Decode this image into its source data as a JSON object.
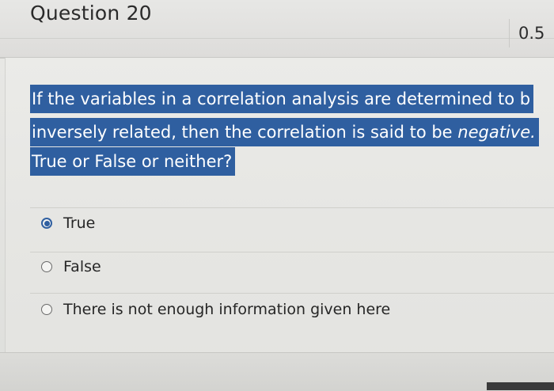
{
  "question": {
    "title": "Question 20",
    "points": "0.5",
    "prompt_lines": [
      "If the variables in a correlation analysis are determined to b",
      "inversely related, then the correlation is said to be ",
      "True or False or neither?"
    ],
    "prompt_emphasis": "negative.",
    "options": [
      {
        "label": "True",
        "selected": true
      },
      {
        "label": "False",
        "selected": false
      },
      {
        "label": "There is not enough information given here",
        "selected": false
      }
    ]
  },
  "colors": {
    "highlight": "#2f5fa0",
    "background": "#e6e6e3",
    "text": "#262626"
  }
}
